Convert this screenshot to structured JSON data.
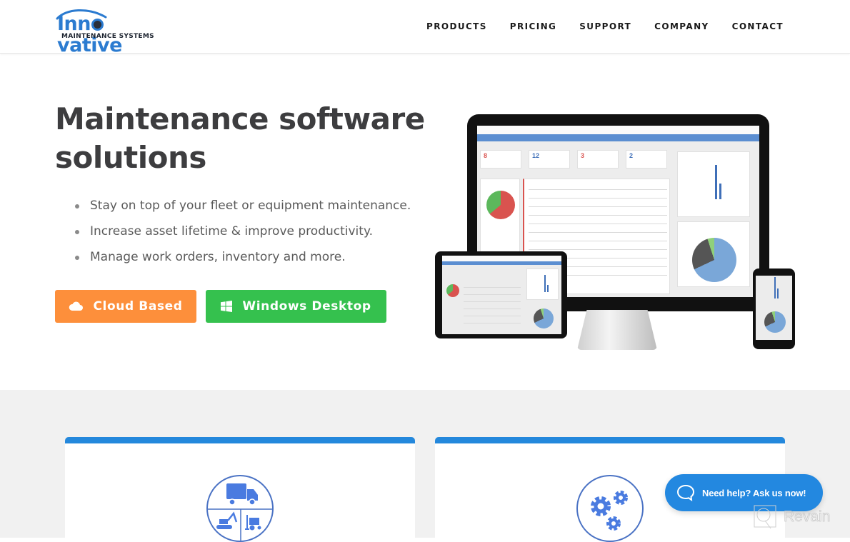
{
  "brand": {
    "name_part1": "Inn",
    "name_part2": "vative",
    "tagline": "MAINTENANCE SYSTEMS",
    "primary_color": "#2b7bd0"
  },
  "nav": {
    "items": [
      {
        "label": "PRODUCTS"
      },
      {
        "label": "PRICING"
      },
      {
        "label": "SUPPORT"
      },
      {
        "label": "COMPANY"
      },
      {
        "label": "CONTACT"
      }
    ]
  },
  "hero": {
    "title_line1": "Maintenance software",
    "title_line2": "solutions",
    "bullets": [
      "Stay on top of your fleet or equipment maintenance.",
      "Increase asset lifetime & improve productivity.",
      "Manage work orders, inventory and more."
    ],
    "buttons": {
      "cloud": {
        "label": "Cloud Based",
        "icon": "cloud-icon",
        "color": "#fd8f3b"
      },
      "windows": {
        "label": "Windows Desktop",
        "icon": "windows-icon",
        "color": "#35c14e"
      }
    },
    "illustration": {
      "description": "desktop, tablet and phone showing dashboard",
      "dashboard_counts": [
        "8",
        "12",
        "3",
        "2"
      ]
    }
  },
  "features": {
    "cards": [
      {
        "icon": "fleet-equipment-icon"
      },
      {
        "icon": "gears-icon"
      }
    ],
    "accent_color": "#2488dc"
  },
  "chat": {
    "label": "Need help? Ask us now!",
    "color": "#2388e0"
  },
  "watermark": {
    "label": "Revain"
  }
}
